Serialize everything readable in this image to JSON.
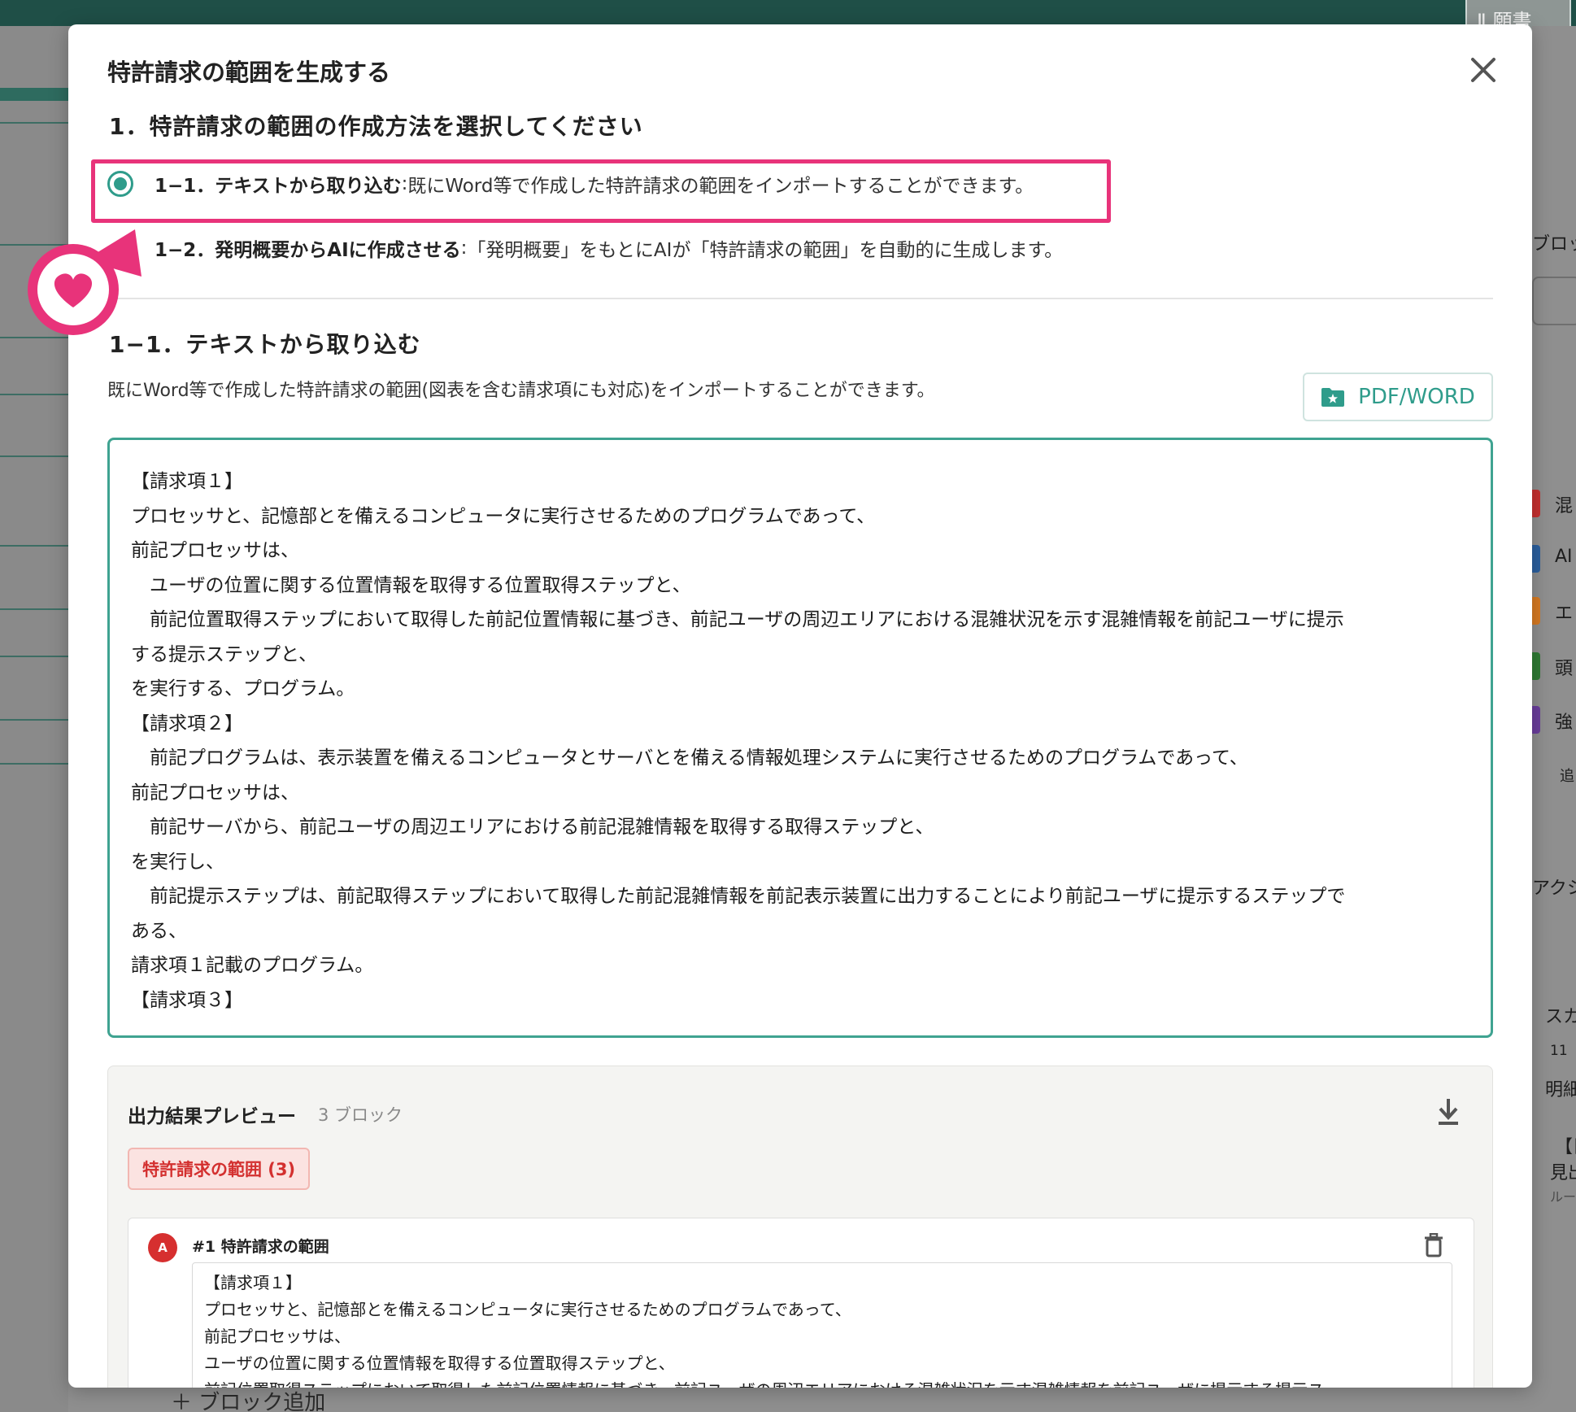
{
  "background": {
    "top_button_label": "Ⅱ 願書",
    "right_texts": [
      "ブロッ",
      "混",
      "AI",
      "エ",
      "頭",
      "強",
      "追",
      "アクシ",
      "スカ",
      "11",
      "明細",
      "【目",
      "見出",
      "ルー"
    ],
    "bottom_text": "＋ ブロック追加"
  },
  "modal": {
    "title": "特許請求の範囲を生成する",
    "step_heading": "1．特許請求の範囲の作成方法を選択してください",
    "options": [
      {
        "label": "1−1．テキストから取り込む",
        "separator": ":",
        "description": " 既にWord等で作成した特許請求の範囲をインポートすることができます。",
        "selected": true
      },
      {
        "label": "1−2．発明概要からAIに作成させる",
        "separator": ":",
        "description": " 「発明概要」をもとにAIが「特許請求の範囲」を自動的に生成します。",
        "selected": false
      }
    ],
    "sub_heading": "1−1．テキストから取り込む",
    "sub_description": "既にWord等で作成した特許請求の範囲(図表を含む請求項にも対応)をインポートすることができます。",
    "import_button_label": "PDF/WORD",
    "claims_lines": [
      "【請求項１】",
      "プロセッサと、記憶部とを備えるコンピュータに実行させるためのプログラムであって、",
      "前記プロセッサは、",
      "　ユーザの位置に関する位置情報を取得する位置取得ステップと、",
      "　前記位置取得ステップにおいて取得した前記位置情報に基づき、前記ユーザの周辺エリアにおける混雑状況を示す混雑情報を前記ユーザに提示",
      "する提示ステップと、",
      "を実行する、プログラム。",
      "【請求項２】",
      "　前記プログラムは、表示装置を備えるコンピュータとサーバとを備える情報処理システムに実行させるためのプログラムであって、",
      "前記プロセッサは、",
      "　前記サーバから、前記ユーザの周辺エリアにおける前記混雑情報を取得する取得ステップと、",
      "を実行し、",
      "　前記提示ステップは、前記取得ステップにおいて取得した前記混雑情報を前記表示装置に出力することにより前記ユーザに提示するステップで",
      "ある、",
      "請求項１記載のプログラム。",
      "【請求項３】"
    ],
    "preview": {
      "title": "出力結果プレビュー",
      "count": "3 ブロック",
      "tag": "特許請求の範囲 (3)",
      "block": {
        "avatar": "A",
        "title": "#1 特許請求の範囲",
        "lines": [
          "【請求項１】",
          "プロセッサと、記憶部とを備えるコンピュータに実行させるためのプログラムであって、",
          "前記プロセッサは、",
          "ユーザの位置に関する位置情報を取得する位置取得ステップと、",
          "前記位置取得ステップにおいて取得した前記位置情報に基づき、前記ユーザの周辺エリアにおける混雑状況を示す混雑情報を前記ユーザに提示する提示ス"
        ]
      }
    }
  },
  "colors": {
    "accent": "#2f9c8b",
    "highlight": "#e8337a",
    "tag_text": "#d3302f",
    "avatar": "#d62f2f"
  }
}
